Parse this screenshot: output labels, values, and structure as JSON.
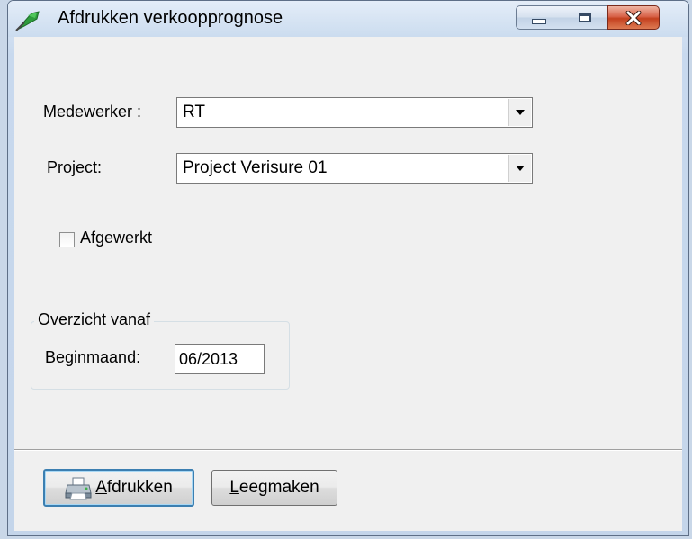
{
  "window": {
    "title": "Afdrukken verkoopprognose"
  },
  "form": {
    "medewerker_label": "Medewerker :",
    "medewerker_value": "RT",
    "project_label": "Project:",
    "project_value": "Project Verisure 01",
    "afgewerkt_label": "Afgewerkt",
    "afgewerkt_checked": false
  },
  "overzicht": {
    "caption": "Overzicht vanaf",
    "beginmaand_label": "Beginmaand:",
    "beginmaand_value": "06/2013"
  },
  "buttons": {
    "print_mnemonic": "A",
    "print_rest": "fdrukken",
    "clear_mnemonic": "L",
    "clear_rest": "eegmaken"
  },
  "icons": {
    "app": "green-flag-icon",
    "print": "printer-icon"
  },
  "colors": {
    "accent": "#3c7fb1",
    "close": "#c4401f",
    "app_icon": "#2e9c3c"
  }
}
